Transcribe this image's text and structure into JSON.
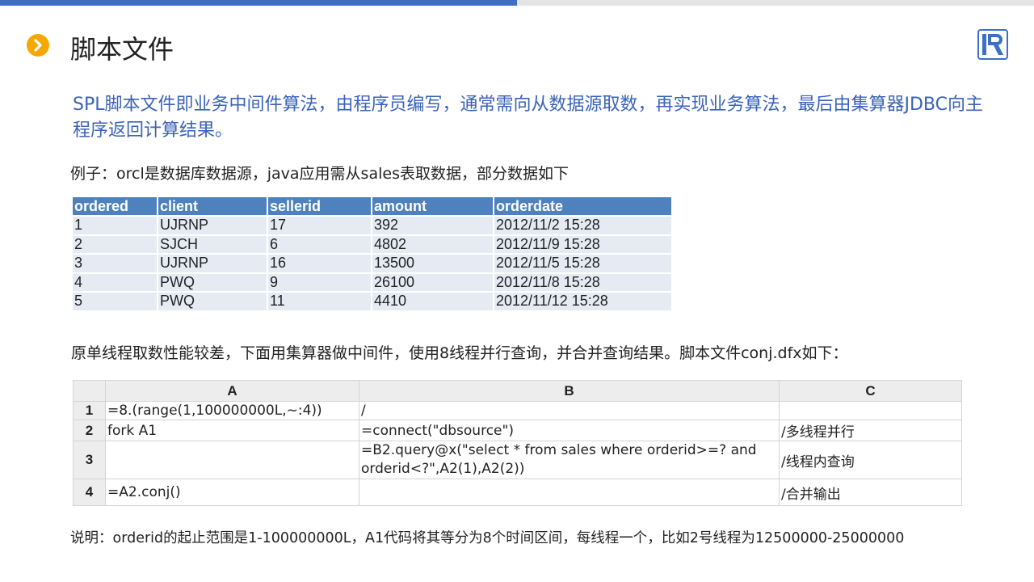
{
  "slide": {
    "title": "脚本文件",
    "intro": "SPL脚本文件即业务中间件算法，由程序员编写，通常需向从数据源取数，再实现业务算法，最后由集算器JDBC向主程序返回计算结果。",
    "example": "例子：orcl是数据库数据源，java应用需从sales表取数据，部分数据如下",
    "para2": "原单线程取数性能较差，下面用集算器做中间件，使用8线程并行查询，并合并查询结果。脚本文件conj.dfx如下：",
    "note": "说明：orderid的起止范围是1-100000000L，A1代码将其等分为8个时间区间，每线程一个，比如2号线程为12500000-25000000"
  },
  "icons": {
    "bullet": "chevron-right-icon",
    "logo": "raqsoft-logo-icon"
  },
  "colors": {
    "accent_blue": "#3d6fc6",
    "bullet_orange": "#f5a800",
    "table_header": "#4f81bd",
    "table_row": "#e6ebf3",
    "intro_text": "#3a63b8"
  },
  "sales_table": {
    "columns": [
      "ordered",
      "client",
      "sellerid",
      "amount",
      "orderdate"
    ],
    "rows": [
      [
        "1",
        "UJRNP",
        "17",
        "392",
        "2012/11/2 15:28"
      ],
      [
        "2",
        "SJCH",
        "6",
        "4802",
        "2012/11/9 15:28"
      ],
      [
        "3",
        "UJRNP",
        "16",
        "13500",
        "2012/11/5 15:28"
      ],
      [
        "4",
        "PWQ",
        "9",
        "26100",
        "2012/11/8 15:28"
      ],
      [
        "5",
        "PWQ",
        "11",
        "4410",
        "2012/11/12 15:28"
      ]
    ]
  },
  "script_grid": {
    "columns": [
      "A",
      "B",
      "C"
    ],
    "rows": [
      {
        "num": "1",
        "cells": [
          "=8.(range(1,100000000L,~:4))",
          "/",
          ""
        ]
      },
      {
        "num": "2",
        "cells": [
          "fork A1",
          "=connect(\"dbsource\")",
          "/多线程并行"
        ]
      },
      {
        "num": "3",
        "cells": [
          "",
          "=B2.query@x(\"select * from sales where orderid>=? and orderid<?\",A2(1),A2(2))",
          "/线程内查询"
        ]
      },
      {
        "num": "4",
        "cells": [
          "=A2.conj()",
          "",
          "/合并输出"
        ]
      }
    ]
  }
}
